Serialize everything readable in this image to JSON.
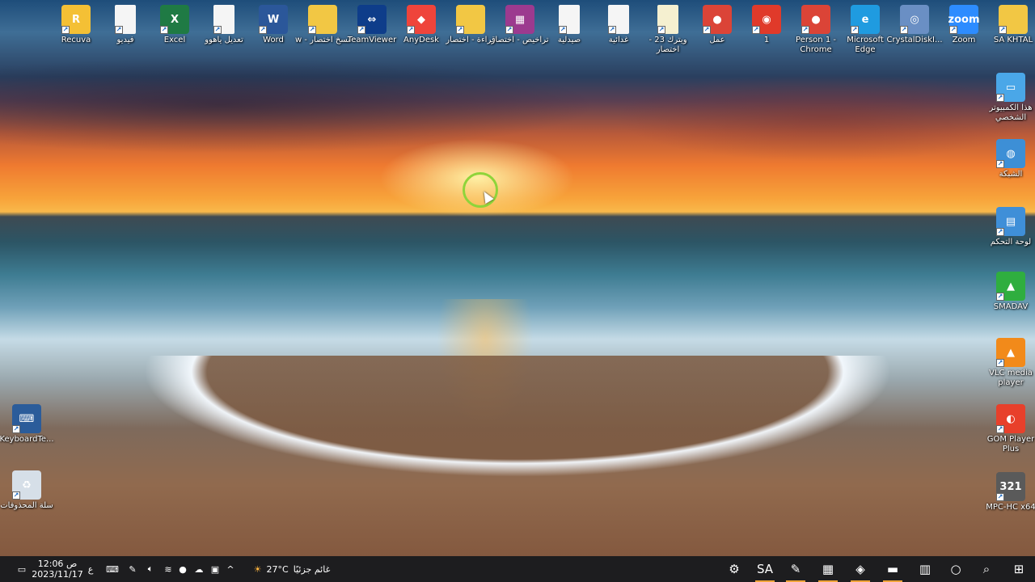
{
  "desktop_icons_top": [
    {
      "label": "Recuva",
      "glyph": "R",
      "color": "#f4c035"
    },
    {
      "label": "فيديو",
      "glyph": "",
      "color": "#f5f5f5"
    },
    {
      "label": "Excel",
      "glyph": "X",
      "color": "#1f7a44"
    },
    {
      "label": "تعديل ياهوو",
      "glyph": "",
      "color": "#f5f5f5"
    },
    {
      "label": "Word",
      "glyph": "W",
      "color": "#2b579a"
    },
    {
      "label": "w - نسخ اختصار",
      "glyph": "",
      "color": "#f2c744"
    },
    {
      "label": "TeamViewer",
      "glyph": "⇔",
      "color": "#0e3d8a"
    },
    {
      "label": "AnyDesk",
      "glyph": "◆",
      "color": "#ef443b"
    },
    {
      "label": "قراءة - اختصار",
      "glyph": "",
      "color": "#f2c744"
    },
    {
      "label": "تراخيص - اختصار",
      "glyph": "▦",
      "color": "#9c3a8f"
    },
    {
      "label": "صيدلية",
      "glyph": "",
      "color": "#f5f5f5"
    },
    {
      "label": "غدائية",
      "glyph": "",
      "color": "#f5f5f5"
    },
    {
      "label": "ويترك 23 - اختصار",
      "glyph": "",
      "color": "#f5f0d0"
    },
    {
      "label": "عمل",
      "glyph": "●",
      "color": "#db4437"
    },
    {
      "label": "1",
      "glyph": "◉",
      "color": "#e03a2a"
    },
    {
      "label": "Person 1 - Chrome",
      "glyph": "●",
      "color": "#db4437"
    },
    {
      "label": "Microsoft Edge",
      "glyph": "e",
      "color": "#1f9be0"
    },
    {
      "label": "CrystalDiskI...",
      "glyph": "◎",
      "color": "#6a8fc4"
    },
    {
      "label": "Zoom",
      "glyph": "zoom",
      "color": "#2d8cff"
    },
    {
      "label": "SA KHTAL",
      "glyph": "",
      "color": "#f2c744"
    }
  ],
  "desktop_icons_right": [
    {
      "label": "هذا الكمبيوتر الشخصي",
      "glyph": "▭",
      "color": "#4aa7e8"
    },
    {
      "label": "الشبكة",
      "glyph": "◍",
      "color": "#3d8fd6"
    },
    {
      "label": "لوحة التحكم",
      "glyph": "▤",
      "color": "#3f8fd8"
    },
    {
      "label": "SMADAV",
      "glyph": "▲",
      "color": "#2fae3f"
    },
    {
      "label": "VLC media player",
      "glyph": "▲",
      "color": "#f28a1a"
    },
    {
      "label": "GOM Player Plus",
      "glyph": "◐",
      "color": "#e8402b"
    },
    {
      "label": "MPC-HC x64",
      "glyph": "321",
      "color": "#5a5a5a"
    }
  ],
  "desktop_icons_left": [
    {
      "label": "KeyboardTe...",
      "glyph": "⌨",
      "color": "#2b5c9a"
    },
    {
      "label": "سلة المحذوفات",
      "glyph": "♻",
      "color": "#d6dfe8"
    }
  ],
  "taskbar": {
    "time": "12:06 ص",
    "date": "2023/11/17",
    "language": "ع",
    "weather_temp": "27°C",
    "weather_text": "غائم جزئيًا",
    "tray_icons": [
      "keyboard-icon",
      "pen-icon",
      "speaker-icon",
      "wifi-icon",
      "mic-icon",
      "cloud-icon",
      "battery-icon",
      "chevron-up-icon"
    ],
    "pinned": [
      {
        "name": "settings",
        "glyph": "⚙"
      },
      {
        "name": "sa-app",
        "glyph": "SA"
      },
      {
        "name": "paint-app",
        "glyph": "✎"
      },
      {
        "name": "calculator",
        "glyph": "▦"
      },
      {
        "name": "store",
        "glyph": "◈"
      },
      {
        "name": "file-explorer",
        "glyph": "▬"
      },
      {
        "name": "task-view",
        "glyph": "▥"
      },
      {
        "name": "cortana",
        "glyph": "○"
      },
      {
        "name": "search",
        "glyph": "⌕"
      },
      {
        "name": "start",
        "glyph": "⊞"
      }
    ]
  }
}
